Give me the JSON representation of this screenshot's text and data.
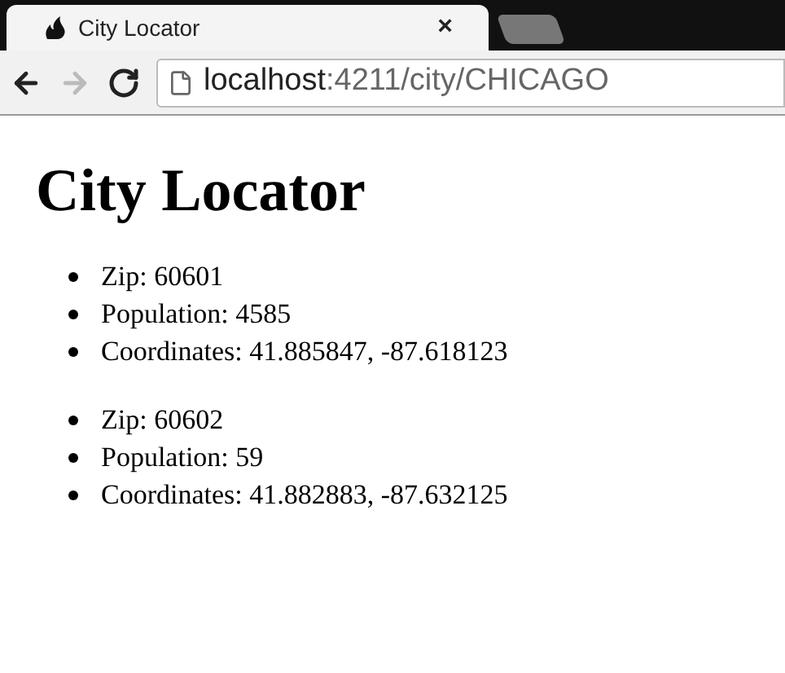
{
  "browser": {
    "tab": {
      "title": "City Locator",
      "close": "×",
      "selected": true
    },
    "back_disabled": false,
    "forward_disabled": true,
    "address": {
      "host": "localhost",
      "path": ":4211/city/CHICAGO"
    }
  },
  "page": {
    "heading": "City Locator",
    "cities": [
      {
        "items": [
          "Zip: 60601",
          "Population: 4585",
          "Coordinates: 41.885847, -87.618123"
        ]
      },
      {
        "items": [
          "Zip: 60602",
          "Population: 59",
          "Coordinates: 41.882883, -87.632125"
        ]
      }
    ]
  }
}
